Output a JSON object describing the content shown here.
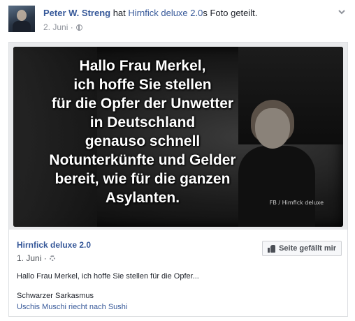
{
  "header": {
    "author": "Peter W. Streng",
    "action_pre": "hat",
    "shared_page": "Hirnfick deluxe 2.0",
    "action_post": "s Foto geteilt.",
    "date": "2. Juni ·"
  },
  "photo": {
    "meme_text": "Hallo Frau Merkel,\nich hoffe Sie stellen\nfür die Opfer der Unwetter\nin Deutschland\ngenauso schnell\nNotunterkünfte und Gelder\nbereit, wie für die ganzen\nAsylanten.",
    "watermark": "FB / Himfick deluxe"
  },
  "shared_post": {
    "page_name": "Hirnfick deluxe 2.0",
    "date": "1. Juni ·",
    "like_button_label": "Seite gefällt mir",
    "caption": "Hallo Frau Merkel, ich hoffe Sie stellen für die Opfer...",
    "subline_1": "Schwarzer Sarkasmus",
    "subline_2": "Uschis Muschi riecht nach Sushi"
  }
}
